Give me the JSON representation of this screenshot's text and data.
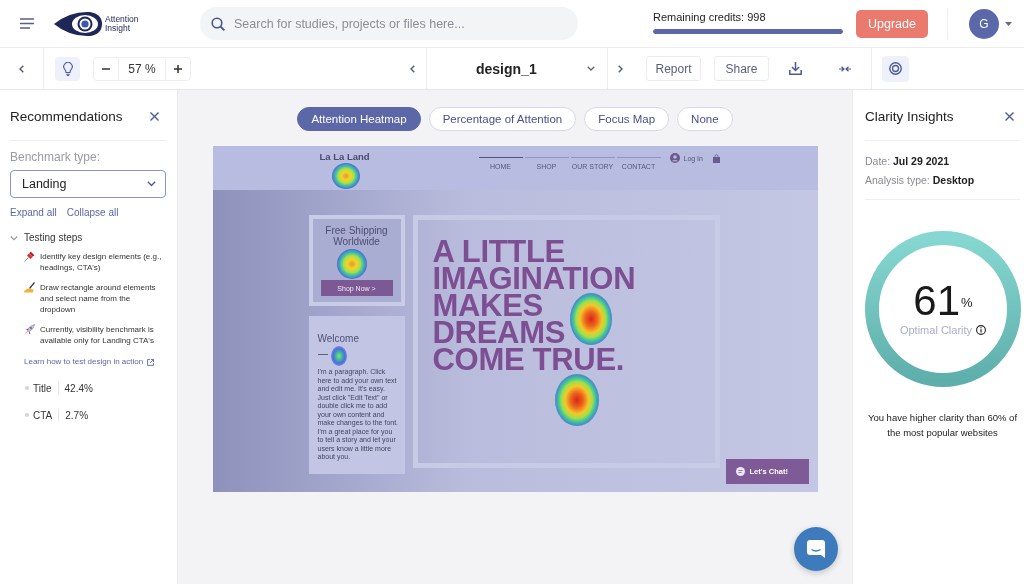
{
  "header": {
    "logo": "Attention Insight",
    "search": {
      "placeholder": "Search for studies, projects or files here..."
    },
    "credits": {
      "label": "Remaining credits: 998",
      "level": 1
    },
    "upgrade": "Upgrade",
    "avatar": "G"
  },
  "toolbar": {
    "recommendations_toggle": {
      "on": true
    },
    "zoom": "57 %",
    "design_name": "design_1",
    "buttons": [
      "Report",
      "Share"
    ],
    "insights_toggle": {
      "on": true
    }
  },
  "recommendations": {
    "title": "Recommendations",
    "benchmark_label": "Benchmark type:",
    "benchmark_value": "Landing",
    "expand_all": "Expand all",
    "collapse_all": "Collapse all",
    "section": {
      "title": "Testing steps",
      "expanded": true,
      "steps": [
        {
          "kind": "pin",
          "text": "Identify key design elements (e.g., headings, CTA's)"
        },
        {
          "kind": "writing",
          "text": "Draw rectangle around elements and select name from the dropdown"
        },
        {
          "kind": "rocket",
          "text": "Currently, visibility benchmark is available only for Landing CTA's"
        }
      ]
    },
    "link": "Learn how to test design in action",
    "metrics": [
      {
        "name": "Title",
        "value": "42.4%"
      },
      {
        "name": "CTA",
        "value": "2.7%"
      }
    ]
  },
  "view_modes": [
    {
      "label": "Attention Heatmap",
      "selected": true
    },
    {
      "label": "Percentage of Attention",
      "selected": false
    },
    {
      "label": "Focus Map",
      "selected": false
    },
    {
      "label": "None",
      "selected": false
    }
  ],
  "design": {
    "logo": "La La Land",
    "nav": [
      {
        "label": "HOME",
        "selected": true
      },
      {
        "label": "SHOP",
        "selected": false
      },
      {
        "label": "OUR STORY",
        "selected": false
      },
      {
        "label": "CONTACT",
        "selected": false
      }
    ],
    "login": "Log In",
    "promo": {
      "title": "Free Shipping Worldwide",
      "button": "Shop Now >"
    },
    "welcome": {
      "title": "Welcome",
      "text": "I'm a paragraph. Click here to add your own text and edit me. It's easy. Just click \"Edit Text\" or double click me to add your own content and make changes to the font. I'm a great place for you to tell a story and let your users know a little more about you."
    },
    "headline_lines": [
      "A LITTLE",
      "IMAGINATION",
      "MAKES",
      "DREAMS",
      "COME TRUE."
    ],
    "chat_button": "Let's Chat!"
  },
  "insights": {
    "title": "Clarity Insights",
    "date": "Date: **Jul 29 2021**",
    "analysis_type": "Analysis type: **Desktop**",
    "score": "61$^{%}$",
    "score_label": "Optimal Clarity",
    "summary": "You have higher clarity than 60% of the most popular websites"
  }
}
